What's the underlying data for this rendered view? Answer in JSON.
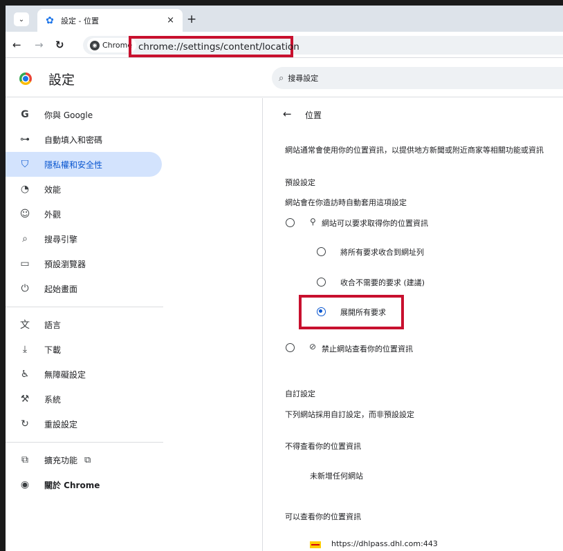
{
  "browser": {
    "tab": {
      "title": "設定 - 位置",
      "favicon": "gear-icon"
    },
    "new_tab": "+",
    "close": "×",
    "site_chip": "Chrome",
    "url_host": "chrome://settings",
    "url_path": "/content/location"
  },
  "header": {
    "title": "設定",
    "search_placeholder": "搜尋設定"
  },
  "sidebar": {
    "items": [
      {
        "icon": "google-icon",
        "glyph": "G",
        "label": "你與 Google"
      },
      {
        "icon": "key-icon",
        "glyph": "⊶",
        "label": "自動填入和密碼"
      },
      {
        "icon": "shield-icon",
        "glyph": "⛉",
        "label": "隱私權和安全性",
        "active": true
      },
      {
        "icon": "gauge-icon",
        "glyph": "◔",
        "label": "效能"
      },
      {
        "icon": "palette-icon",
        "glyph": "☺",
        "label": "外觀"
      },
      {
        "icon": "search-icon",
        "glyph": "⌕",
        "label": "搜尋引擎"
      },
      {
        "icon": "browser-icon",
        "glyph": "▭",
        "label": "預設瀏覽器"
      },
      {
        "icon": "power-icon",
        "glyph": "⏻",
        "label": "起始畫面"
      },
      {
        "icon": "translate-icon",
        "glyph": "文",
        "label": "語言"
      },
      {
        "icon": "download-icon",
        "glyph": "⤓",
        "label": "下載"
      },
      {
        "icon": "accessibility-icon",
        "glyph": "♿",
        "label": "無障礙設定"
      },
      {
        "icon": "wrench-icon",
        "glyph": "⚒",
        "label": "系統"
      },
      {
        "icon": "reset-icon",
        "glyph": "↻",
        "label": "重設設定"
      },
      {
        "icon": "extension-icon",
        "glyph": "⧉",
        "label": "擴充功能"
      },
      {
        "icon": "chrome-icon",
        "glyph": "◉",
        "label": "關於 Chrome"
      }
    ]
  },
  "main": {
    "title": "位置",
    "description": "網站通常會使用你的位置資訊，以提供地方新聞或附近商家等相關功能或資訊",
    "default_heading": "預設設定",
    "default_sub": "網站會在你造訪時自動套用這項設定",
    "option_allow": "網站可以要求取得你的位置資訊",
    "sub_option_1": "將所有要求收合到網址列",
    "sub_option_2": "收合不需要的要求 (建議)",
    "sub_option_3": "展開所有要求",
    "option_block": "禁止網站查看你的位置資訊",
    "custom_heading": "自訂設定",
    "custom_sub": "下列網站採用自訂設定，而非預設設定",
    "blocked_heading": "不得查看你的位置資訊",
    "blocked_empty": "未新增任何網站",
    "allowed_heading": "可以查看你的位置資訊",
    "allowed_site": "https://dhlpass.dhl.com:443"
  },
  "colors": {
    "accent": "#0b57d0",
    "highlight": "#c8102e",
    "active_bg": "#d3e3fd"
  }
}
